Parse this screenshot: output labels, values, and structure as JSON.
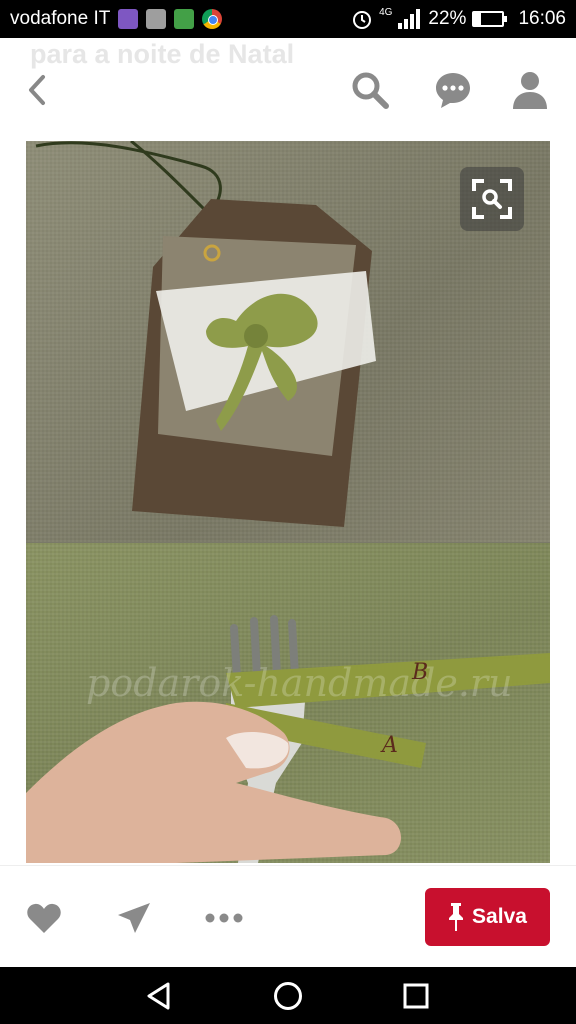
{
  "status_bar": {
    "carrier": "vodafone IT",
    "network": "4G",
    "battery_percent": "22%",
    "battery_level": 0.22,
    "time": "16:06",
    "notification_icons": [
      "viber-icon",
      "gallery-icon",
      "shield-icon",
      "chrome-icon"
    ]
  },
  "header": {
    "faded_title": "para a noite de Natal",
    "buttons": [
      "back-icon",
      "search-icon",
      "comment-icon",
      "profile-icon"
    ]
  },
  "image": {
    "watermark": "podarok-handmade.ru",
    "ribbon_letters": [
      "A",
      "B"
    ],
    "lens_icon": "visual-search-icon"
  },
  "actions": {
    "icons": [
      "heart-icon",
      "send-icon",
      "more-icon"
    ],
    "save_label": "Salva",
    "save_icon": "pin-icon",
    "save_color": "#c8102e"
  },
  "nav": {
    "buttons": [
      "back-triangle-icon",
      "home-circle-icon",
      "recents-square-icon"
    ]
  }
}
